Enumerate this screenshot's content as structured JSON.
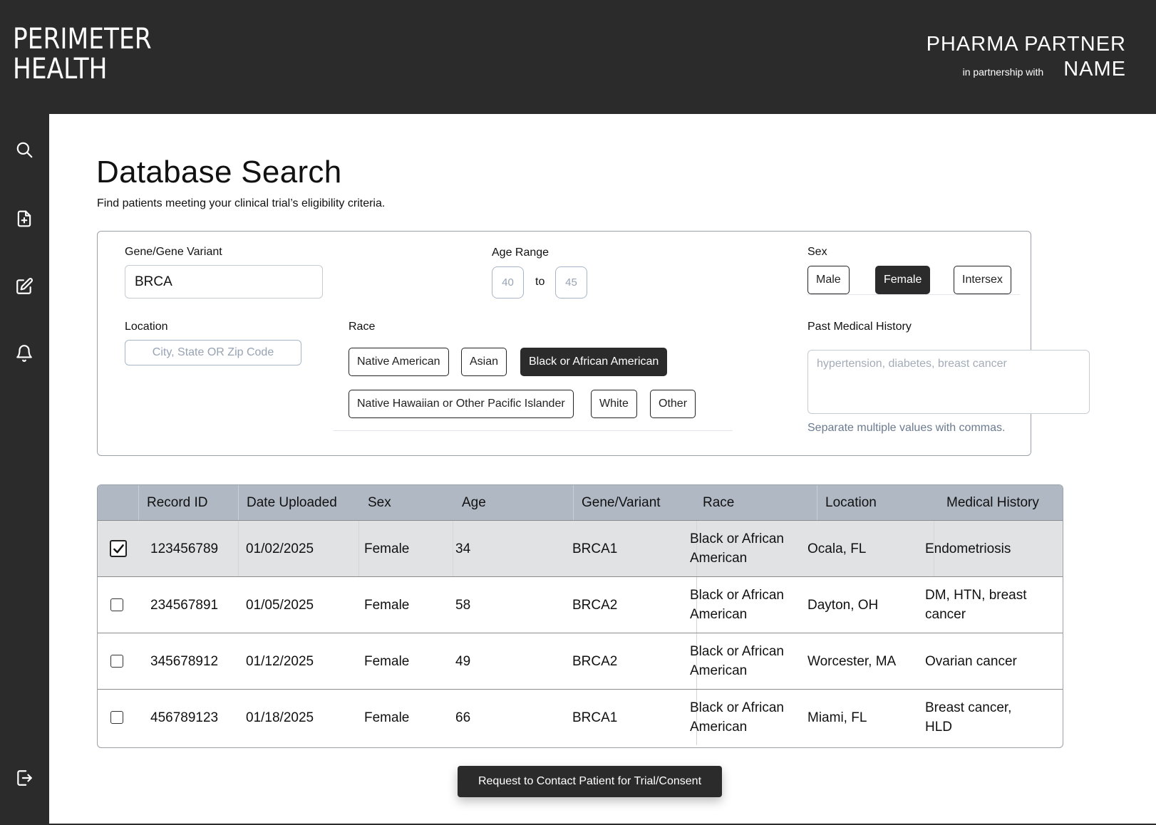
{
  "brand": {
    "logo_line1": "PERIMETER",
    "logo_line2": "HEALTH"
  },
  "partner": {
    "line1": "PHARMA PARTNER",
    "sub": "in partnership with",
    "line2": "NAME"
  },
  "sidebar": {
    "items": [
      {
        "icon": "search-icon"
      },
      {
        "icon": "file-add-icon"
      },
      {
        "icon": "edit-icon"
      },
      {
        "icon": "bell-icon"
      },
      {
        "icon": "logout-icon"
      }
    ]
  },
  "page": {
    "title": "Database Search",
    "subtitle": "Find patients meeting your clinical trial’s eligibility criteria."
  },
  "filters": {
    "gene": {
      "label": "Gene/Gene Variant",
      "value": "BRCA"
    },
    "age": {
      "label": "Age Range",
      "min_placeholder": "40",
      "to": "to",
      "max_placeholder": "45"
    },
    "sex": {
      "label": "Sex",
      "options": [
        "Male",
        "Female",
        "Intersex"
      ],
      "selected": "Female"
    },
    "location": {
      "label": "Location",
      "placeholder": "City, State OR Zip Code"
    },
    "race": {
      "label": "Race",
      "options": [
        "Native American",
        "Asian",
        "Black or African American",
        "Native Hawaiian or Other Pacific Islander",
        "White",
        "Other"
      ],
      "selected": "Black or African American"
    },
    "history": {
      "label": "Past Medical History",
      "placeholder": "hypertension, diabetes, breast cancer",
      "help": "Separate multiple values with commas."
    }
  },
  "table": {
    "columns": [
      "Record ID",
      "Date Uploaded",
      "Sex",
      "Age",
      "Gene/Variant",
      "Race",
      "Location",
      "Medical History"
    ],
    "rows": [
      {
        "checked": true,
        "record_id": "123456789",
        "date": "01/02/2025",
        "sex": "Female",
        "age": "34",
        "gene": "BRCA1",
        "race": "Black or African American",
        "location": "Ocala, FL",
        "history": "Endometriosis"
      },
      {
        "checked": false,
        "record_id": "234567891",
        "date": "01/05/2025",
        "sex": "Female",
        "age": "58",
        "gene": "BRCA2",
        "race": "Black or African American",
        "location": "Dayton, OH",
        "history": "DM, HTN, breast cancer"
      },
      {
        "checked": false,
        "record_id": "345678912",
        "date": "01/12/2025",
        "sex": "Female",
        "age": "49",
        "gene": "BRCA2",
        "race": "Black or African American",
        "location": "Worcester, MA",
        "history": "Ovarian cancer"
      },
      {
        "checked": false,
        "record_id": "456789123",
        "date": "01/18/2025",
        "sex": "Female",
        "age": "66",
        "gene": "BRCA1",
        "race": "Black or African American",
        "location": "Miami, FL",
        "history": "Breast cancer, HLD"
      }
    ]
  },
  "cta": {
    "label": "Request to Contact Patient for Trial/Consent"
  },
  "colors": {
    "dark": "#2b2b2b",
    "table_header": "#b0b8c4",
    "selected_row": "#e1e2e4",
    "muted_text": "#6b7b8f"
  }
}
